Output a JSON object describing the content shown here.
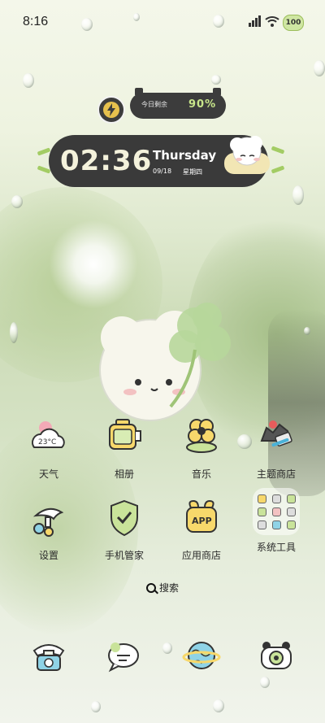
{
  "status_bar": {
    "time": "8:16",
    "battery_level": "100",
    "battery_color": "#cfe6a2"
  },
  "battery_widget": {
    "label": "今日剩余",
    "percent": "90%",
    "icon": "lightning-bolt-icon"
  },
  "clock_widget": {
    "time": "02:36",
    "day": "Thursday",
    "date": "09/18",
    "weekday": "星期四",
    "accent": "#a3cc64"
  },
  "apps_row1": [
    {
      "label": "天气",
      "icon": "weather-cloud-icon",
      "badge": "23°C"
    },
    {
      "label": "相册",
      "icon": "photo-album-icon"
    },
    {
      "label": "音乐",
      "icon": "music-flower-icon"
    },
    {
      "label": "主题商店",
      "icon": "theme-store-icon"
    }
  ],
  "apps_row2": [
    {
      "label": "设置",
      "icon": "settings-icon"
    },
    {
      "label": "手机管家",
      "icon": "phone-manager-icon"
    },
    {
      "label": "应用商店",
      "icon": "app-store-icon",
      "badge": "APP"
    },
    {
      "label": "系统工具",
      "icon": "system-tools-folder-icon"
    }
  ],
  "search": {
    "label": "搜索"
  },
  "dock": [
    {
      "icon": "phone-icon"
    },
    {
      "icon": "messages-icon"
    },
    {
      "icon": "browser-globe-icon"
    },
    {
      "icon": "camera-icon"
    }
  ]
}
